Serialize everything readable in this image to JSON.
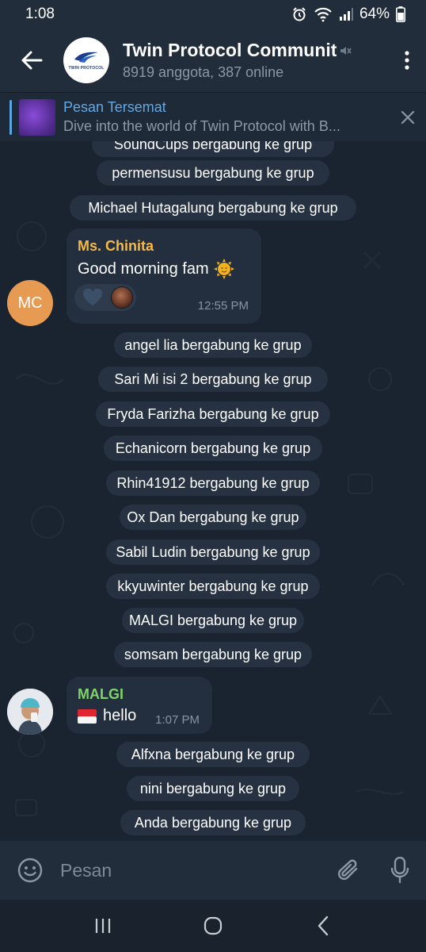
{
  "status_bar": {
    "time": "1:08",
    "battery": "64%"
  },
  "header": {
    "title": "Twin Protocol Communit",
    "subtitle": "8919 anggota, 387 online",
    "avatar_logo_text": "TWIN PROTOCOL"
  },
  "pinned": {
    "title": "Pesan Tersemat",
    "preview": "Dive into the world of Twin Protocol with B..."
  },
  "chat": {
    "top_partial_service": "SoundCups bergabung ke grup",
    "services_a": [
      "permensusu bergabung ke grup",
      "Michael Hutagalung bergabung ke grup"
    ],
    "message1": {
      "avatar_initials": "MC",
      "sender": "Ms. Chinita",
      "sender_color": "#f5b94a",
      "text": "Good morning fam",
      "emoji": "sun-with-face",
      "time": "12:55 PM",
      "reaction": "heart"
    },
    "services_b": [
      "angel lia bergabung ke grup",
      "Sari Mi isi 2 bergabung ke grup",
      "Fryda Farizha bergabung ke grup",
      "Echanicorn bergabung ke grup",
      "Rhin41912 bergabung ke grup",
      "Ox Dan bergabung ke grup",
      "Sabil Ludin bergabung ke grup",
      "kkyuwinter bergabung ke grup",
      "MALGI bergabung ke grup",
      "somsam bergabung ke grup"
    ],
    "message2": {
      "sender": "MALGI",
      "sender_color": "#7fd46b",
      "flag": "indonesia-flag",
      "text": "hello",
      "time": "1:07 PM"
    },
    "services_c": [
      "Alfxna bergabung ke grup",
      "nini bergabung ke grup",
      "Anda bergabung ke grup"
    ]
  },
  "input": {
    "placeholder": "Pesan"
  },
  "colors": {
    "header_bg": "#212d3b",
    "chat_bg": "#1a2330",
    "bubble_bg": "#232f3f",
    "accent_blue": "#62a8e3"
  }
}
